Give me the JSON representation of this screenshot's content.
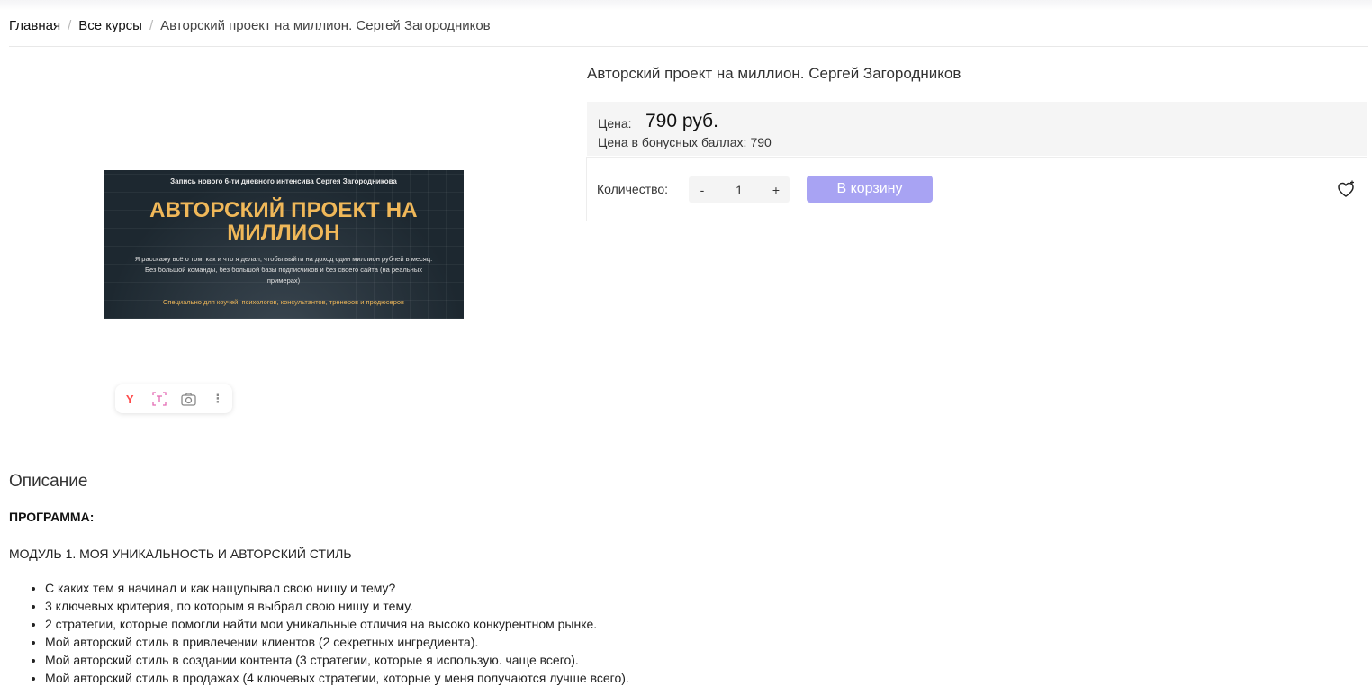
{
  "breadcrumb": {
    "items": [
      "Главная",
      "Все курсы"
    ],
    "current": "Авторский проект на миллион. Сергей Загородников",
    "separator": "/"
  },
  "product": {
    "title": "Авторский проект на миллион. Сергей Загородников",
    "image": {
      "subtitle": "Запись нового 6-ти дневного интенсива Сергея Загородникова",
      "headline": "АВТОРСКИЙ ПРОЕКТ НА МИЛЛИОН",
      "description": "Я расскажу всё о том, как и что я делал, чтобы выйти на доход один миллион рублей в месяц. Без большой команды, без большой базы подписчиков и без своего сайта (на реальных примерах)",
      "footer": "Специально для коучей, психологов, консультантов, тренеров и продюсеров"
    },
    "image_toolbar": {
      "icons": [
        "yandex-icon",
        "text-select-icon",
        "camera-icon",
        "more-vertical-icon"
      ]
    },
    "price": {
      "label": "Цена:",
      "value": "790 руб.",
      "bonus_label": "Цена в бонусных баллах:",
      "bonus_value": "790"
    },
    "quantity": {
      "label": "Количество:",
      "minus": "-",
      "value": "1",
      "plus": "+"
    },
    "cart_button": "В корзину",
    "accent_color": "#a8a3f3"
  },
  "description": {
    "heading": "Описание",
    "program": "ПРОГРАММА:",
    "module_title": "МОДУЛЬ 1. МОЯ УНИКАЛЬНОСТЬ И АВТОРСКИЙ СТИЛЬ",
    "items": [
      "С каких тем я начинал и как нащупывал свою нишу и тему?",
      "3 ключевых критерия, по которым я выбрал свою нишу и тему.",
      "2 стратегии, которые помогли найти мои уникальные отличия на высоко конкурентном рынке.",
      "Мой авторский стиль в привлечении клиентов (2 секретных ингредиента).",
      "Мой авторский стиль в создании контента (3 стратегии, которые я использую. чаще всего).",
      "Мой авторский стиль в продажах (4 ключевых стратегии, которые у меня получаются лучше всего)."
    ]
  }
}
